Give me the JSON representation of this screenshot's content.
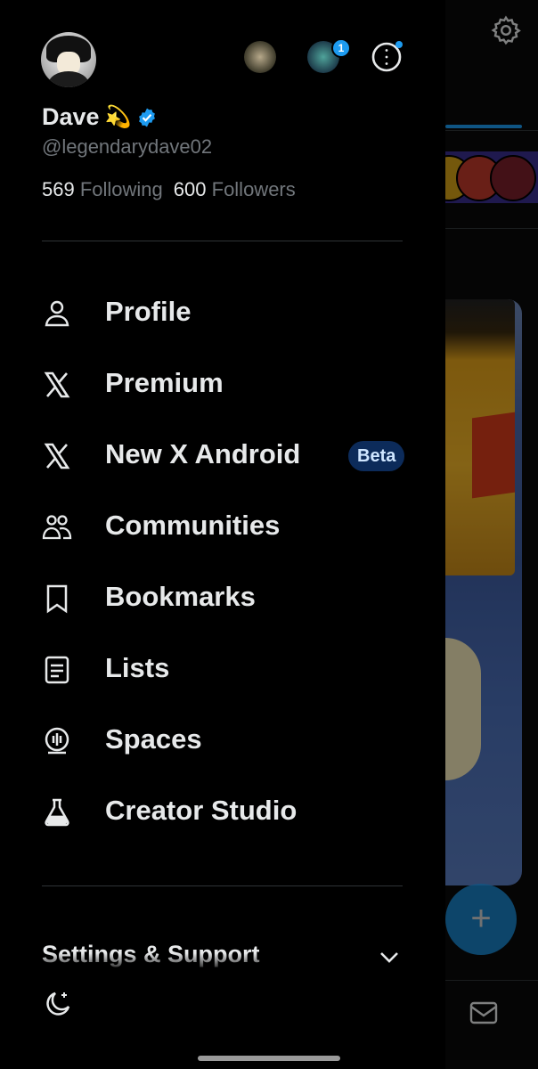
{
  "user": {
    "name": "Dave",
    "emoji": "💫",
    "handle": "@legendarydave02",
    "following_count": "569",
    "following_label": "Following",
    "followers_count": "600",
    "followers_label": "Followers",
    "other_accounts_badge": "1"
  },
  "menu": {
    "items": [
      {
        "label": "Profile",
        "icon": "person-icon"
      },
      {
        "label": "Premium",
        "icon": "x-logo-icon"
      },
      {
        "label": "New X Android",
        "icon": "x-logo-icon",
        "tag": "Beta"
      },
      {
        "label": "Communities",
        "icon": "communities-icon"
      },
      {
        "label": "Bookmarks",
        "icon": "bookmark-icon"
      },
      {
        "label": "Lists",
        "icon": "list-icon"
      },
      {
        "label": "Spaces",
        "icon": "spaces-icon"
      },
      {
        "label": "Creator Studio",
        "icon": "flask-icon"
      }
    ]
  },
  "footer": {
    "settings_label": "Settings & Support"
  },
  "colors": {
    "accent": "#1d9bf0",
    "background": "#000000",
    "text": "#e7e9ea",
    "muted": "#71767b"
  }
}
